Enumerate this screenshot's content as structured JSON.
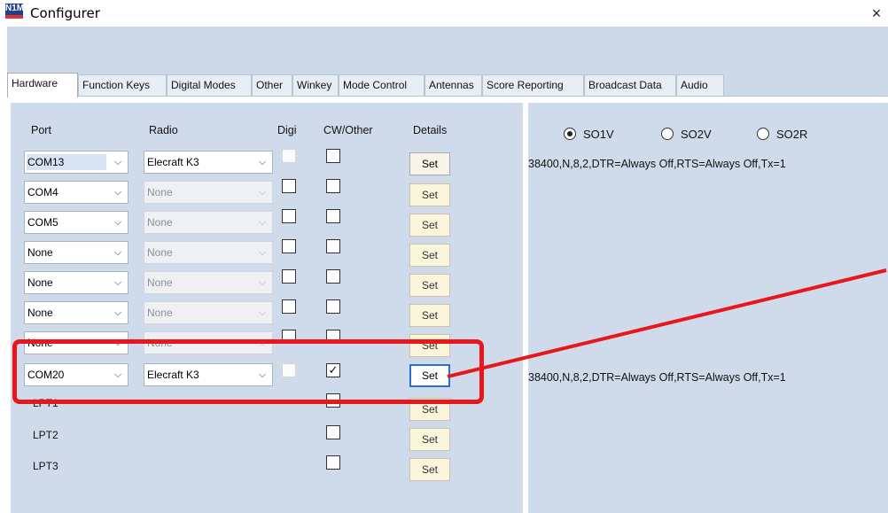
{
  "window": {
    "title": "Configurer",
    "logo_text": "N1MM",
    "close_glyph": "×"
  },
  "tabs": [
    {
      "label": "Hardware",
      "active": true
    },
    {
      "label": "Function Keys"
    },
    {
      "label": "Digital Modes"
    },
    {
      "label": "Other"
    },
    {
      "label": "Winkey"
    },
    {
      "label": "Mode Control"
    },
    {
      "label": "Antennas"
    },
    {
      "label": "Score Reporting"
    },
    {
      "label": "Broadcast Data"
    },
    {
      "label": "Audio"
    }
  ],
  "table": {
    "headers": {
      "port": "Port",
      "radio": "Radio",
      "digi": "Digi",
      "cw": "CW/Other",
      "details": "Details"
    },
    "rows": [
      {
        "port": "COM13",
        "radio": "Elecraft K3",
        "radio_enabled": true,
        "digi_enabled": false,
        "cw_checked": false,
        "set": "Set"
      },
      {
        "port": "COM4",
        "radio": "None",
        "radio_enabled": false,
        "digi_enabled": true,
        "cw_checked": false,
        "set": "Set"
      },
      {
        "port": "COM5",
        "radio": "None",
        "radio_enabled": false,
        "digi_enabled": true,
        "cw_checked": false,
        "set": "Set"
      },
      {
        "port": "None",
        "radio": "None",
        "radio_enabled": false,
        "digi_enabled": true,
        "cw_checked": false,
        "set": "Set"
      },
      {
        "port": "None",
        "radio": "None",
        "radio_enabled": false,
        "digi_enabled": true,
        "cw_checked": false,
        "set": "Set"
      },
      {
        "port": "None",
        "radio": "None",
        "radio_enabled": false,
        "digi_enabled": true,
        "cw_checked": false,
        "set": "Set"
      },
      {
        "port": "None",
        "radio": "None",
        "radio_enabled": false,
        "digi_enabled": true,
        "cw_checked": false,
        "set": "Set"
      },
      {
        "port": "COM20",
        "radio": "Elecraft K3",
        "radio_enabled": true,
        "digi_enabled": false,
        "cw_checked": true,
        "set": "Set"
      }
    ],
    "lpt_rows": [
      {
        "port": "LPT1",
        "cw_checked": false,
        "set": "Set"
      },
      {
        "port": "LPT2",
        "cw_checked": false,
        "set": "Set"
      },
      {
        "port": "LPT3",
        "cw_checked": false,
        "set": "Set"
      }
    ],
    "arrow_glyph": "⌵",
    "check_glyph": "✓"
  },
  "mode": {
    "options": [
      {
        "label": "SO1V",
        "checked": true
      },
      {
        "label": "SO2V",
        "checked": false
      },
      {
        "label": "SO2R",
        "checked": false
      }
    ]
  },
  "port_settings": {
    "row1": "38400,N,8,2,DTR=Always Off,RTS=Always Off,Tx=1",
    "row8": "38400,N,8,2,DTR=Always Off,RTS=Always Off,Tx=1"
  },
  "colors": {
    "annotation": "#e8171c",
    "panel_bg": "#cfdbeb",
    "set_button": "#fbf5dc"
  }
}
